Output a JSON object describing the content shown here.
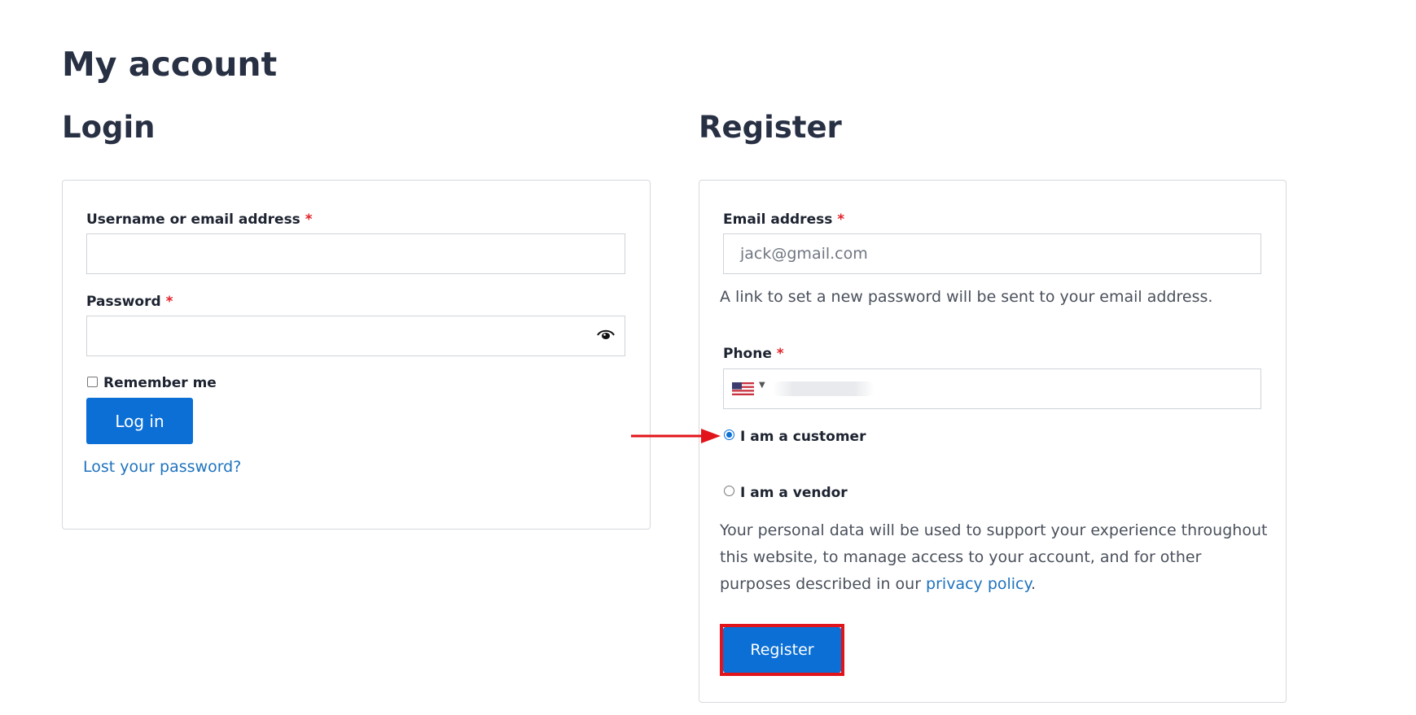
{
  "page": {
    "title": "My account"
  },
  "login": {
    "heading": "Login",
    "username_label": "Username or email address",
    "username_value": "",
    "password_label": "Password",
    "password_value": "",
    "required_marker": "*",
    "remember_label": "Remember me",
    "remember_checked": false,
    "submit_label": "Log in",
    "lost_password_link": "Lost your password?"
  },
  "register": {
    "heading": "Register",
    "email_label": "Email address",
    "email_value": "jack@gmail.com",
    "required_marker": "*",
    "email_hint": "A link to set a new password will be sent to your email address.",
    "phone_label": "Phone",
    "phone_country": "us-flag-icon",
    "role_options": [
      {
        "label": "I am a customer",
        "selected": true
      },
      {
        "label": "I am a vendor",
        "selected": false
      }
    ],
    "privacy_text_before": "Your personal data will be used to support your experience throughout this website, to manage access to your account, and for other purposes described in our",
    "privacy_link": "privacy policy",
    "privacy_text_after": ".",
    "submit_label": "Register"
  },
  "annotations": {
    "arrow_color": "#e2141b",
    "highlight_color": "#e2141b"
  },
  "colors": {
    "accent": "#0b6fd5",
    "link": "#1e73be",
    "required": "#e2222a",
    "heading": "#283043"
  }
}
